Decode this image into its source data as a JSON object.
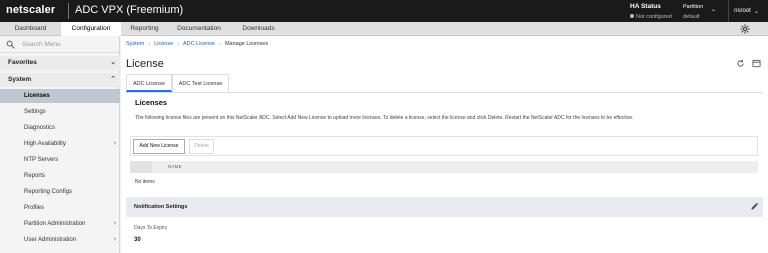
{
  "header": {
    "brand": "netscaler",
    "app_title": "ADC VPX (Freemium)",
    "ha_status_title": "HA Status",
    "ha_status_value": "Not configured",
    "partition_label": "Partition",
    "partition_value": "default",
    "user": "nsroot"
  },
  "main_tabs": [
    {
      "label": "Dashboard"
    },
    {
      "label": "Configuration"
    },
    {
      "label": "Reporting"
    },
    {
      "label": "Documentation"
    },
    {
      "label": "Downloads"
    }
  ],
  "active_main_tab": "Configuration",
  "sidebar": {
    "search_placeholder": "Search Menu",
    "sections": [
      {
        "label": "Favorites"
      },
      {
        "label": "System"
      }
    ],
    "items": [
      {
        "label": "Licenses"
      },
      {
        "label": "Settings"
      },
      {
        "label": "Diagnostics"
      },
      {
        "label": "High Availability"
      },
      {
        "label": "NTP Servers"
      },
      {
        "label": "Reports"
      },
      {
        "label": "Reporting Configs"
      },
      {
        "label": "Profiles"
      },
      {
        "label": "Partition Administration"
      },
      {
        "label": "User Administration"
      }
    ],
    "active_item": "Licenses"
  },
  "breadcrumb": [
    "System",
    "License",
    "ADC License",
    "Manage Licenses"
  ],
  "page_title": "License",
  "sub_tabs": [
    {
      "label": "ADC License"
    },
    {
      "label": "ADC Test License"
    }
  ],
  "active_sub_tab": "ADC License",
  "licenses": {
    "title": "Licenses",
    "description": "The following license files are present on this NetScaler ADC. Select Add New License to upload more licenses. To delete a license, select the license and click Delete. Restart the NetScaler ADC for the licenses to be effective.",
    "add_button": "Add New License",
    "delete_button": "Delete",
    "columns": [
      "NAME"
    ],
    "empty_text": "No items"
  },
  "notification": {
    "title": "Notification Settings",
    "field_label": "Days To Expiry",
    "field_value": "30"
  },
  "colors": {
    "topbar": "#1a1a1a",
    "accent": "#1a73e8",
    "active_sidebar": "#bfc8d0"
  }
}
